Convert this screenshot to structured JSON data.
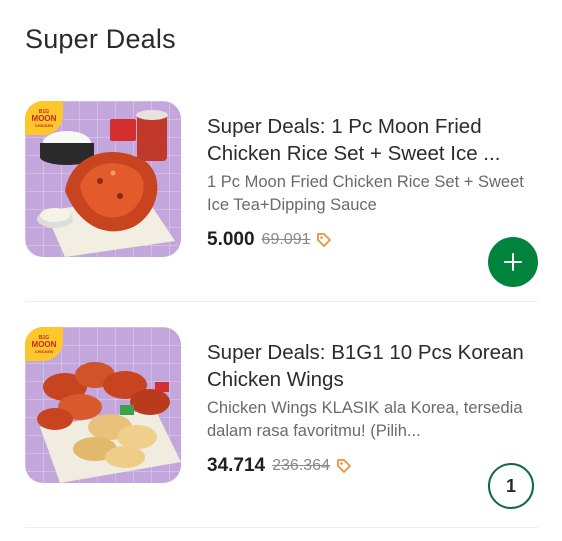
{
  "section": {
    "title": "Super Deals"
  },
  "deals": [
    {
      "title": "Super Deals: 1 Pc Moon Fried Chicken Rice Set + Sweet Ice ...",
      "description": "1 Pc Moon Fried Chicken Rice Set + Sweet Ice Tea+Dipping Sauce",
      "price": "5.000",
      "original_price": "69.091",
      "action": "add",
      "action_icon": "plus-icon"
    },
    {
      "title": "Super Deals: B1G1 10 Pcs Korean Chicken Wings",
      "description": "Chicken Wings KLASIK ala Korea, tersedia dalam rasa favoritmu! (Pilih...",
      "price": "34.714",
      "original_price": "236.364",
      "action": "quantity",
      "quantity": "1"
    }
  ],
  "brand": {
    "line1": "B1G",
    "line2": "MOON",
    "line3": "CHICKEN"
  },
  "colors": {
    "accent_green": "#00843d",
    "thumb_bg": "#c3a6dc",
    "brand_yellow": "#ffc72c",
    "tag_orange": "#e8943a"
  }
}
